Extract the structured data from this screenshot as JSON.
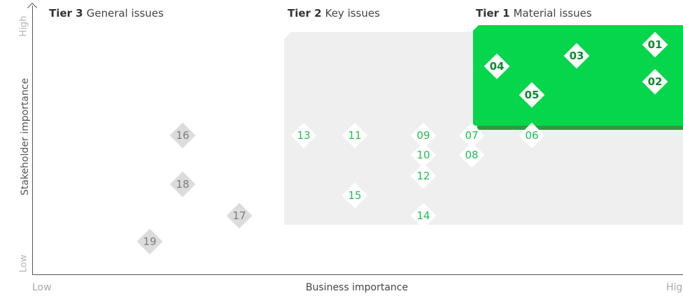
{
  "axes": {
    "y_low": "Low",
    "y_high": "High",
    "y_title": "Stakeholder importance",
    "x_low": "Low",
    "x_high": "High",
    "x_title": "Business importance"
  },
  "tiers": [
    {
      "key": "Tier 3",
      "label": "General issues"
    },
    {
      "key": "Tier 2",
      "label": "Key issues"
    },
    {
      "key": "Tier 1",
      "label": "Material issues"
    }
  ],
  "colors": {
    "tier1_fill": "#05d64b",
    "tier2_fill": "#efefef",
    "tier3_marker": "#dcdcdc"
  },
  "issues": [
    {
      "id": "01",
      "tier": 1
    },
    {
      "id": "02",
      "tier": 1
    },
    {
      "id": "03",
      "tier": 1
    },
    {
      "id": "04",
      "tier": 1
    },
    {
      "id": "05",
      "tier": 1
    },
    {
      "id": "06",
      "tier": 2
    },
    {
      "id": "07",
      "tier": 2
    },
    {
      "id": "08",
      "tier": 2
    },
    {
      "id": "09",
      "tier": 2
    },
    {
      "id": "10",
      "tier": 2
    },
    {
      "id": "11",
      "tier": 2
    },
    {
      "id": "12",
      "tier": 2
    },
    {
      "id": "13",
      "tier": 2
    },
    {
      "id": "14",
      "tier": 2
    },
    {
      "id": "15",
      "tier": 2
    },
    {
      "id": "16",
      "tier": 3
    },
    {
      "id": "17",
      "tier": 3
    },
    {
      "id": "18",
      "tier": 3
    },
    {
      "id": "19",
      "tier": 3
    }
  ]
}
